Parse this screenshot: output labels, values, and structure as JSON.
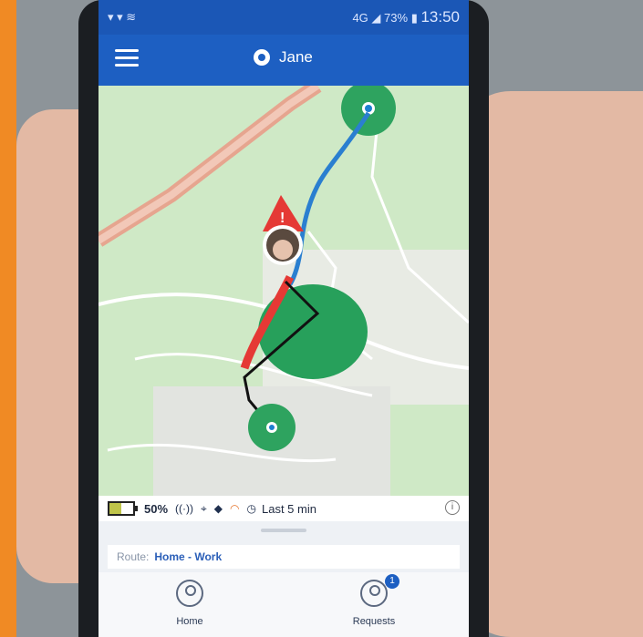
{
  "status_bar": {
    "network": "4G",
    "battery": "73%",
    "time": "13:50"
  },
  "app_bar": {
    "name": "Jane"
  },
  "info_bar": {
    "battery_percent": "50%",
    "battery_level": 0.5,
    "time_window": "Last 5 min",
    "info_symbol": "i"
  },
  "route": {
    "label": "Route:",
    "value": "Home - Work"
  },
  "tabs": [
    {
      "label": "Home"
    },
    {
      "label": "Requests",
      "badge": "1"
    }
  ],
  "colors": {
    "brand": "#1d5fc2",
    "route_path": "#2a7fd0",
    "alert": "#e53935",
    "zone": "#2ea35f"
  }
}
